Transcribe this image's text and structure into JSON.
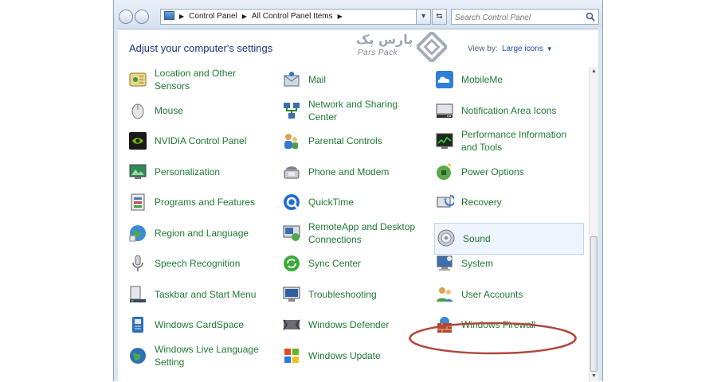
{
  "navbar": {
    "breadcrumb": [
      "Control Panel",
      "All Control Panel Items"
    ],
    "search_placeholder": "Search Control Panel",
    "refresh_glyph": "⇆"
  },
  "page": {
    "heading": "Adjust your computer's settings",
    "view_by_label": "View by:",
    "view_by_value": "Large icons"
  },
  "watermark": {
    "persian": "پارس پک",
    "latin": "Pars Pack"
  },
  "items": [
    {
      "label": "Location and Other Sensors",
      "icon": "location-sensors-icon"
    },
    {
      "label": "Mail",
      "icon": "mail-icon"
    },
    {
      "label": "MobileMe",
      "icon": "mobileme-icon"
    },
    {
      "label": "Mouse",
      "icon": "mouse-icon"
    },
    {
      "label": "Network and Sharing Center",
      "icon": "network-icon"
    },
    {
      "label": "Notification Area Icons",
      "icon": "notification-icon"
    },
    {
      "label": "NVIDIA Control Panel",
      "icon": "nvidia-icon"
    },
    {
      "label": "Parental Controls",
      "icon": "parental-controls-icon"
    },
    {
      "label": "Performance Information and Tools",
      "icon": "performance-icon"
    },
    {
      "label": "Personalization",
      "icon": "personalization-icon"
    },
    {
      "label": "Phone and Modem",
      "icon": "phone-modem-icon"
    },
    {
      "label": "Power Options",
      "icon": "power-options-icon"
    },
    {
      "label": "Programs and Features",
      "icon": "programs-icon"
    },
    {
      "label": "QuickTime",
      "icon": "quicktime-icon"
    },
    {
      "label": "Recovery",
      "icon": "recovery-icon"
    },
    {
      "label": "Region and Language",
      "icon": "region-icon"
    },
    {
      "label": "RemoteApp and Desktop Connections",
      "icon": "remoteapp-icon"
    },
    {
      "label": "Sound",
      "icon": "sound-icon"
    },
    {
      "label": "Speech Recognition",
      "icon": "speech-icon"
    },
    {
      "label": "Sync Center",
      "icon": "sync-icon"
    },
    {
      "label": "System",
      "icon": "system-icon"
    },
    {
      "label": "Taskbar and Start Menu",
      "icon": "taskbar-icon"
    },
    {
      "label": "Troubleshooting",
      "icon": "troubleshooting-icon"
    },
    {
      "label": "User Accounts",
      "icon": "user-accounts-icon"
    },
    {
      "label": "Windows CardSpace",
      "icon": "cardspace-icon"
    },
    {
      "label": "Windows Defender",
      "icon": "defender-icon"
    },
    {
      "label": "Windows Firewall",
      "icon": "firewall-icon"
    },
    {
      "label": "Windows Live Language Setting",
      "icon": "live-language-icon"
    },
    {
      "label": "Windows Update",
      "icon": "windows-update-icon"
    }
  ],
  "colors": {
    "link_green": "#1f7a36",
    "heading_blue": "#1e3287",
    "highlight_oval": "#b0473a"
  }
}
